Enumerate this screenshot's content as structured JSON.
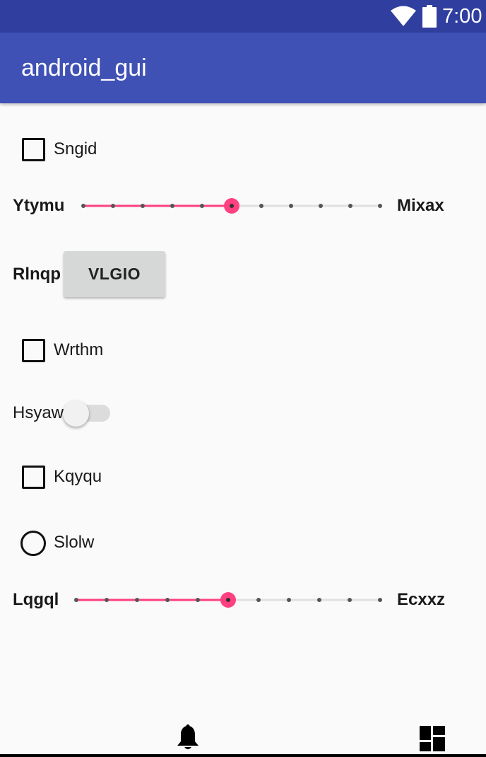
{
  "status_bar": {
    "time": "7:00",
    "icons": [
      "wifi-icon",
      "battery-icon"
    ]
  },
  "app_bar": {
    "title": "android_gui"
  },
  "controls": {
    "checkbox1": {
      "label": "Sngid",
      "checked": false
    },
    "slider1": {
      "start_label": "Ytymu",
      "end_label": "Mixax",
      "steps": 10,
      "value": 5
    },
    "button_row": {
      "label": "Rlnqp",
      "button_text": "VLGIO"
    },
    "checkbox2": {
      "label": "Wrthm",
      "checked": false
    },
    "switch1": {
      "label": "Hsyaw",
      "on": false
    },
    "checkbox3": {
      "label": "Kqyqu",
      "checked": false
    },
    "radio1": {
      "label": "Slolw",
      "selected": false
    },
    "slider2": {
      "start_label": "Lqgql",
      "end_label": "Ecxxz",
      "steps": 10,
      "value": 5
    }
  },
  "bottom_nav": {
    "icons": [
      "bell-icon",
      "dashboard-icon"
    ]
  },
  "colors": {
    "accent": "#ff4081",
    "primary": "#3f51b5",
    "primary_dark": "#303f9f"
  }
}
